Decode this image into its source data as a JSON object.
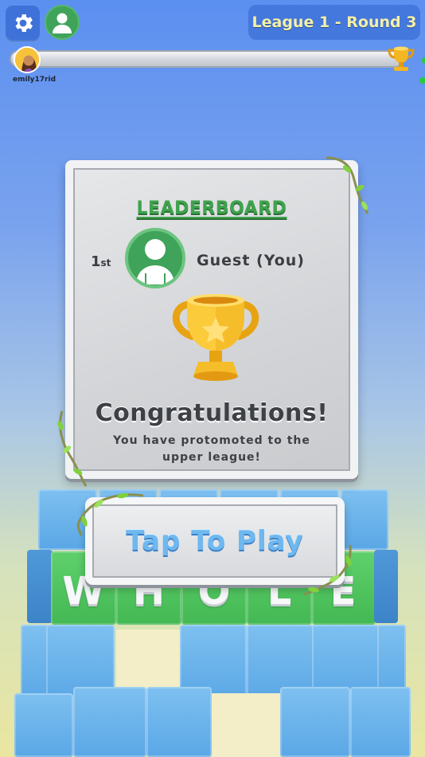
{
  "header": {
    "settings_icon": "gear-icon",
    "profile_icon": "user-avatar-icon",
    "league_label": "League 1 - Round 3"
  },
  "race": {
    "player_name": "emily17rid",
    "finish_icon": "trophy-icon"
  },
  "leaderboard": {
    "title": "LEADERBOARD",
    "rank_number": "1",
    "rank_suffix": "st",
    "player_name": "Guest (You)",
    "trophy_icon": "trophy-icon",
    "headline": "Congratulations!",
    "message_line1": "You have protomoted to the",
    "message_line2": "upper league!"
  },
  "board": {
    "letters": [
      "W",
      "H",
      "O",
      "L",
      "E"
    ]
  },
  "play_button": {
    "label": "Tap To Play"
  },
  "colors": {
    "accent_blue": "#3f72d8",
    "league_text": "#f4f0a8",
    "leaderboard_green": "#3fa34d",
    "play_text": "#6fb8ef",
    "block_green": "#4cc25b",
    "block_blue": "#6ab3ea"
  }
}
